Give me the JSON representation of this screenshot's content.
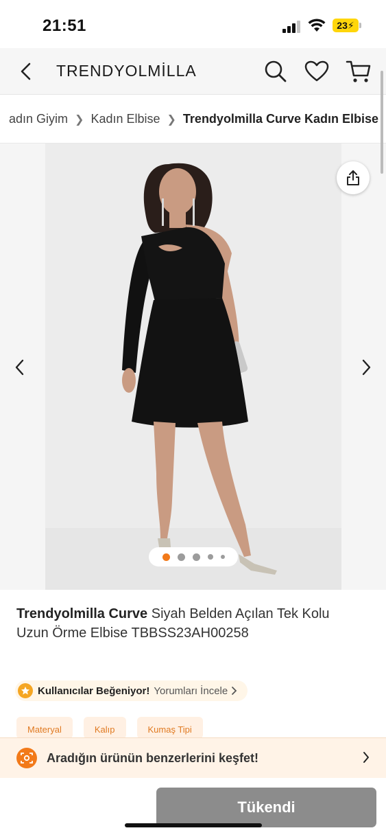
{
  "status_bar": {
    "time": "21:51",
    "battery": "23"
  },
  "header": {
    "brand": "TRENDYOLMİLLA",
    "icons": [
      "back-icon",
      "search-icon",
      "heart-icon",
      "cart-icon"
    ]
  },
  "breadcrumb": {
    "items": [
      "adın Giyim",
      "Kadın Elbise"
    ],
    "current": "Trendyolmilla Curve Kadın Elbise"
  },
  "gallery": {
    "image_count": 5,
    "active_index": 0,
    "accent_color": "#f27a1a"
  },
  "product": {
    "brand": "Trendyolmilla Curve",
    "name": " Siyah Belden Açılan Tek Kolu Uzun Örme Elbise TBBSS23AH00258"
  },
  "rating": {
    "title": "Kullanıcılar Beğeniyor!",
    "link": "Yorumları İncele"
  },
  "attributes": [
    "Materyal",
    "Kalıp",
    "Kumaş Tipi"
  ],
  "discover": {
    "text": "Aradığın ürünün benzerlerini keşfet!"
  },
  "cta": {
    "label": "Tükendi",
    "state": "disabled"
  },
  "colors": {
    "brand_orange": "#f27a1a",
    "soldout_gray": "#8c8c8c"
  }
}
